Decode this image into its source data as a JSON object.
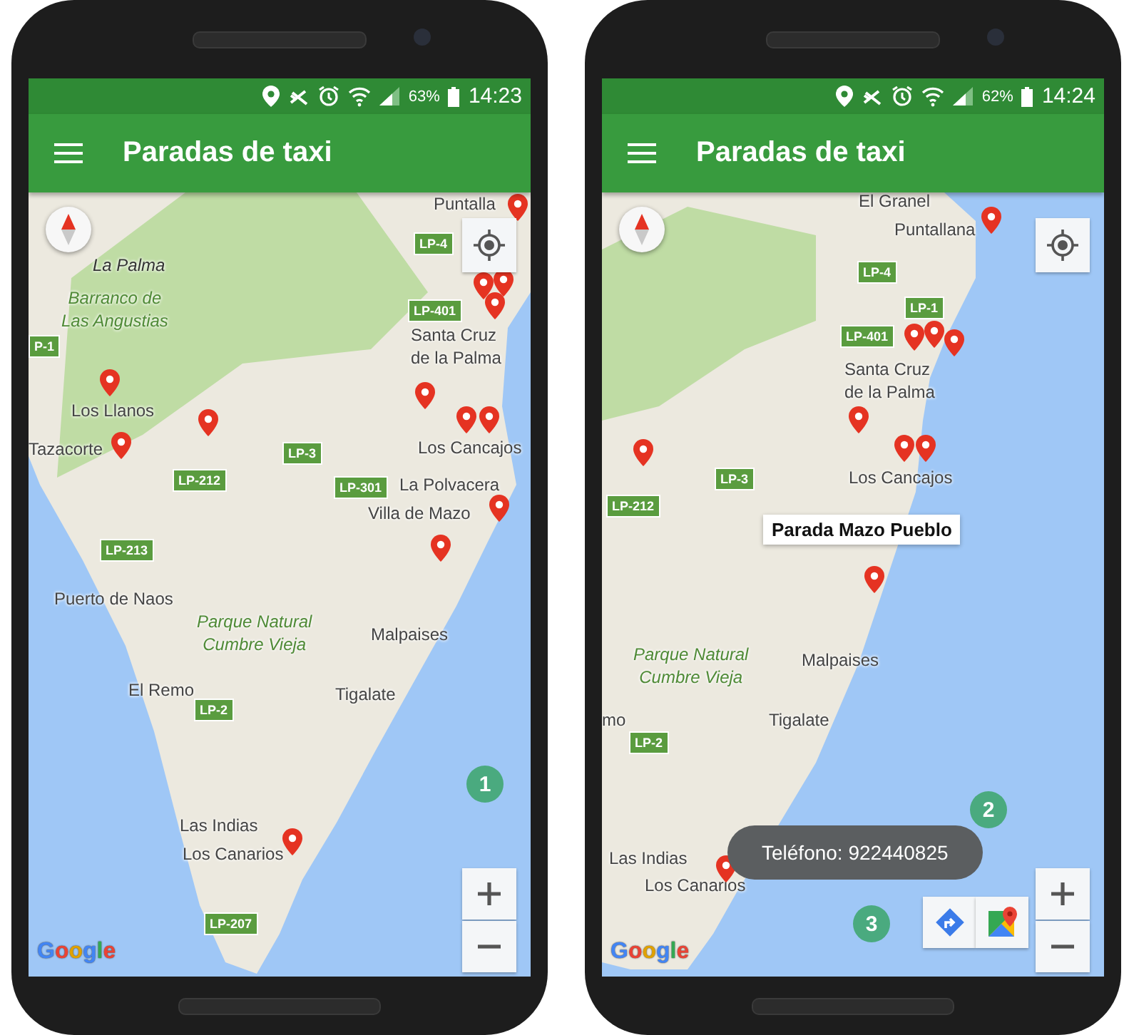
{
  "phones": [
    {
      "status_bar": {
        "battery": "63%",
        "time": "14:23"
      },
      "app_bar": {
        "title": "Paradas de taxi"
      },
      "map": {
        "labels": [
          {
            "text": "Puntalla",
            "kind": "town"
          },
          {
            "text": "LP-4",
            "kind": "road"
          },
          {
            "text": "La Palma",
            "kind": "region"
          },
          {
            "text": "Barranco de\nLas Angustias",
            "kind": "park"
          },
          {
            "text": "P-1",
            "kind": "road"
          },
          {
            "text": "LP-401",
            "kind": "road"
          },
          {
            "text": "Santa Cruz\nde la Palma",
            "kind": "town"
          },
          {
            "text": "Los Llanos",
            "kind": "town"
          },
          {
            "text": "Tazacorte",
            "kind": "town"
          },
          {
            "text": "LP-3",
            "kind": "road"
          },
          {
            "text": "LP-212",
            "kind": "road"
          },
          {
            "text": "LP-301",
            "kind": "road"
          },
          {
            "text": "Los Cancajos",
            "kind": "town"
          },
          {
            "text": "La Polvacera",
            "kind": "town"
          },
          {
            "text": "Villa de Mazo",
            "kind": "town"
          },
          {
            "text": "LP-213",
            "kind": "road"
          },
          {
            "text": "Puerto de Naos",
            "kind": "town"
          },
          {
            "text": "Parque Natural\nCumbre Vieja",
            "kind": "park"
          },
          {
            "text": "Malpaises",
            "kind": "town"
          },
          {
            "text": "El Remo",
            "kind": "town"
          },
          {
            "text": "LP-2",
            "kind": "road"
          },
          {
            "text": "Tigalate",
            "kind": "town"
          },
          {
            "text": "Las Indias",
            "kind": "town"
          },
          {
            "text": "Los Canarios",
            "kind": "town"
          },
          {
            "text": "LP-207",
            "kind": "road"
          }
        ],
        "logo": "Google",
        "badges": [
          "1"
        ]
      }
    },
    {
      "status_bar": {
        "battery": "62%",
        "time": "14:24"
      },
      "app_bar": {
        "title": "Paradas de taxi"
      },
      "map": {
        "labels": [
          {
            "text": "El Granel",
            "kind": "town"
          },
          {
            "text": "Puntallana",
            "kind": "town"
          },
          {
            "text": "LP-4",
            "kind": "road"
          },
          {
            "text": "LP-1",
            "kind": "road"
          },
          {
            "text": "LP-401",
            "kind": "road"
          },
          {
            "text": "Santa Cruz\nde la Palma",
            "kind": "town"
          },
          {
            "text": "LP-3",
            "kind": "road"
          },
          {
            "text": "LP-212",
            "kind": "road"
          },
          {
            "text": "Los Cancajos",
            "kind": "town"
          },
          {
            "text": "Parque Natural\nCumbre Vieja",
            "kind": "park"
          },
          {
            "text": "Malpaises",
            "kind": "town"
          },
          {
            "text": "mo",
            "kind": "town"
          },
          {
            "text": "LP-2",
            "kind": "road"
          },
          {
            "text": "Tigalate",
            "kind": "town"
          },
          {
            "text": "Las Indias",
            "kind": "town"
          },
          {
            "text": "Los Canarios",
            "kind": "town"
          }
        ],
        "info_window": "Parada Mazo Pueblo",
        "toast": "Teléfono: 922440825",
        "logo": "Google",
        "badges": [
          "2",
          "3"
        ],
        "route_buttons": true
      }
    }
  ]
}
